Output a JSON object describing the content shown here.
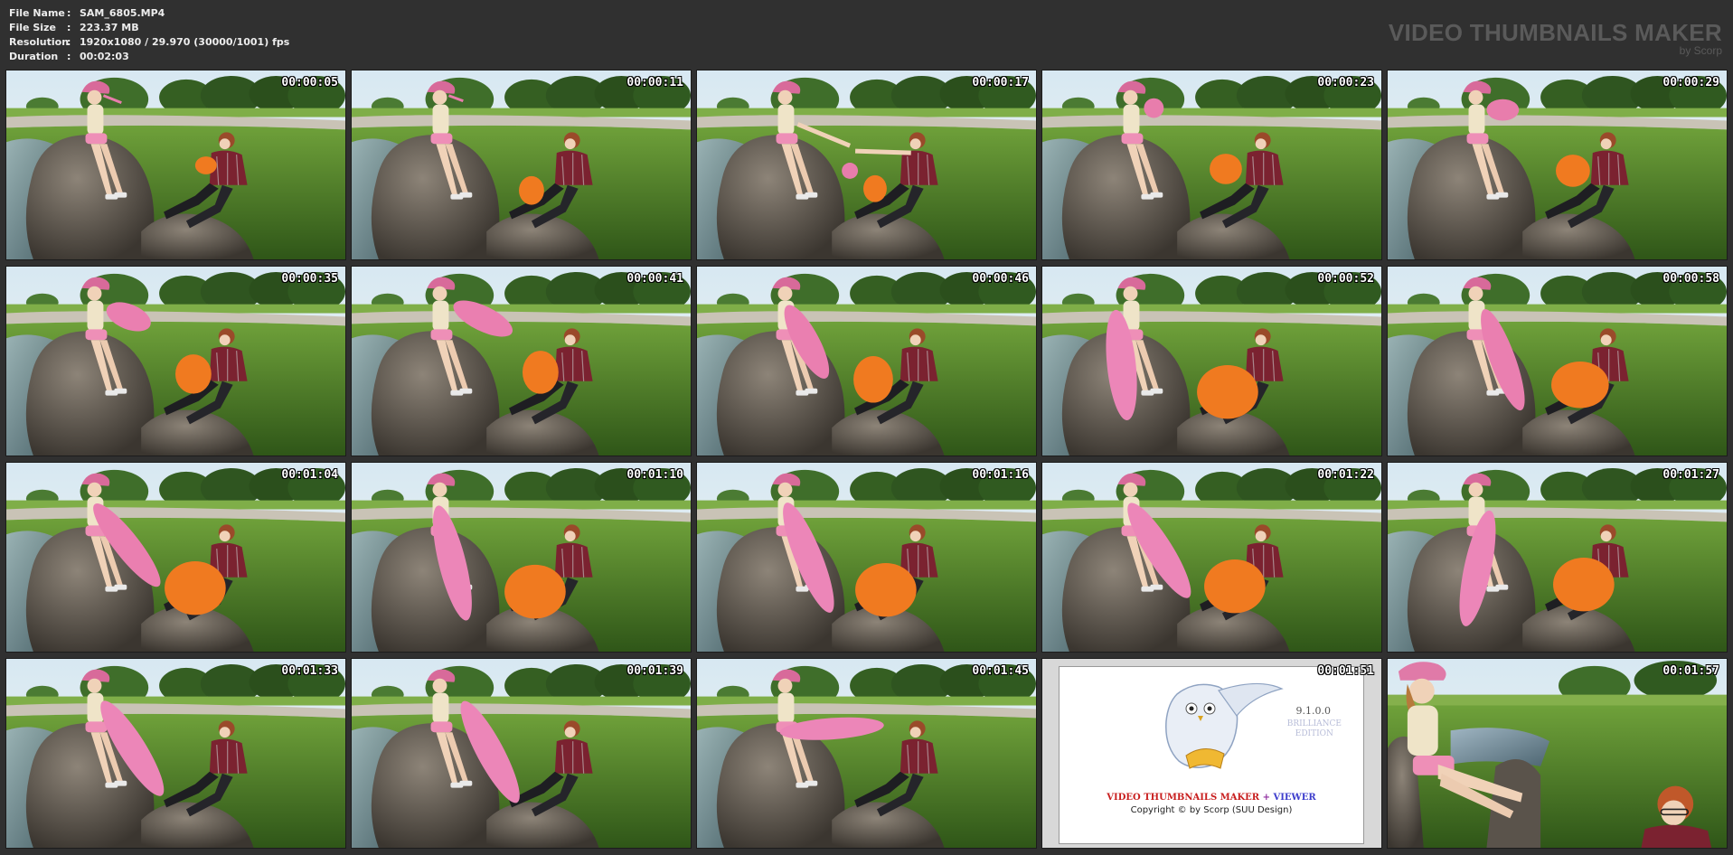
{
  "file_info": [
    {
      "key": "File Name",
      "sep": ":",
      "value": "SAM_6805.MP4"
    },
    {
      "key": "File Size",
      "sep": ":",
      "value": "223.37 MB"
    },
    {
      "key": "Resolution",
      "sep": ":",
      "value": "1920x1080 / 29.970 (30000/1001) fps"
    },
    {
      "key": "Duration",
      "sep": ":",
      "value": "00:02:03"
    }
  ],
  "brand": {
    "title": "VIDEO THUMBNAILS MAKER",
    "by": "by Scorp"
  },
  "timestamps": [
    "00:00:05",
    "00:00:11",
    "00:00:17",
    "00:00:23",
    "00:00:29",
    "00:00:35",
    "00:00:41",
    "00:00:46",
    "00:00:52",
    "00:00:58",
    "00:01:04",
    "00:01:10",
    "00:01:16",
    "00:01:22",
    "00:01:27",
    "00:01:33",
    "00:01:39",
    "00:01:45",
    "00:01:51",
    "00:01:57"
  ],
  "logo_card": {
    "version": "9.1.0.0",
    "edition_line1": "BRILLIANCE",
    "edition_line2": "EDITION",
    "name_part1": "VIDEO THUMBNAILS MAKER",
    "name_plus": " + ",
    "name_part2": "VIEWER",
    "copyright": "Copyright © by Scorp (SUU Design)"
  },
  "colors": {
    "background": "#303030",
    "header_text": "#ededed",
    "brand_text": "#5a5a5a",
    "logo_red": "#c81e1e",
    "logo_blue": "#3c3ccc",
    "logo_purple": "#8e2c9e"
  }
}
